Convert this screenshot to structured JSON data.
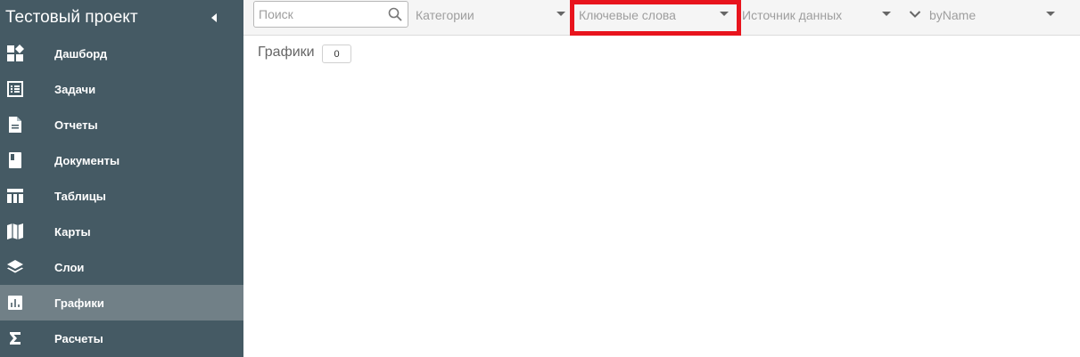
{
  "sidebar": {
    "title": "Тестовый проект",
    "items": [
      {
        "label": "Дашборд",
        "icon": "dashboard-icon"
      },
      {
        "label": "Задачи",
        "icon": "task-list-icon"
      },
      {
        "label": "Отчеты",
        "icon": "report-document-icon"
      },
      {
        "label": "Документы",
        "icon": "book-icon"
      },
      {
        "label": "Таблицы",
        "icon": "table-icon"
      },
      {
        "label": "Карты",
        "icon": "map-icon"
      },
      {
        "label": "Слои",
        "icon": "layers-icon"
      },
      {
        "label": "Графики",
        "icon": "bar-chart-icon",
        "active": true
      },
      {
        "label": "Расчеты",
        "icon": "sigma-icon"
      }
    ]
  },
  "toolbar": {
    "search": {
      "placeholder": "Поиск",
      "value": ""
    },
    "categories_label": "Категории",
    "keywords_label": "Ключевые слова",
    "datasource_label": "Источник данных",
    "sort_label": "byName"
  },
  "main": {
    "section_title": "Графики",
    "count": "0"
  },
  "colors": {
    "sidebar_bg": "#455a64",
    "sidebar_active": "#718087",
    "highlight": "#e8141d"
  }
}
